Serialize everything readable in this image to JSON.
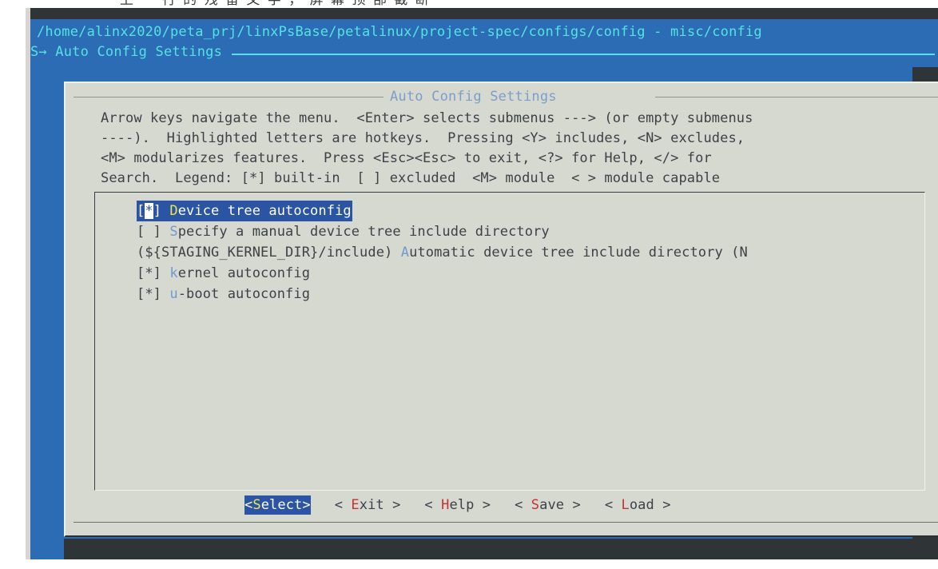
{
  "window": {
    "truncated_top_text": "上 一 行 的 残 留 文 字 ， 屏 幕 顶 部 截 断"
  },
  "terminal": {
    "path_title": "/home/alinx2020/peta_prj/linxPsBase/petalinux/project-spec/configs/config - misc/config",
    "breadcrumb": "S→ Auto Config Settings"
  },
  "dialog": {
    "title": "Auto Config Settings",
    "help_lines": [
      "Arrow keys navigate the menu.  <Enter> selects submenus ---> (or empty submenus",
      "----).  Highlighted letters are hotkeys.  Pressing <Y> includes, <N> excludes,",
      "<M> modularizes features.  Press <Esc><Esc> to exit, <?> for Help, </> for",
      "Search.  Legend: [*] built-in  [ ] excluded  <M> module  < > module capable"
    ],
    "menu_items": [
      {
        "prefix_open": "[",
        "cursor": "*",
        "prefix_close": "] ",
        "hotkey": "D",
        "label": "evice tree autoconfig",
        "selected": true
      },
      {
        "prefix": "[ ] ",
        "hotkey": "S",
        "label": "pecify a manual device tree include directory",
        "selected": false
      },
      {
        "prefix": "(${STAGING_KERNEL_DIR}/include) ",
        "hotkey": "A",
        "label": "utomatic device tree include directory (N",
        "selected": false
      },
      {
        "prefix": "[*] ",
        "hotkey": "k",
        "label": "ernel autoconfig",
        "selected": false
      },
      {
        "prefix": "[*] ",
        "hotkey": "u",
        "label": "-boot autoconfig",
        "selected": false
      }
    ],
    "buttons": [
      {
        "open": "<",
        "hotkey": "S",
        "label": "elect",
        "close": ">",
        "selected": true
      },
      {
        "open": "< ",
        "hotkey": "E",
        "label": "xit",
        "close": " >",
        "selected": false
      },
      {
        "open": "< ",
        "hotkey": "H",
        "label": "elp",
        "close": " >",
        "selected": false
      },
      {
        "open": "< ",
        "hotkey": "S",
        "label": "ave",
        "close": " >",
        "selected": false
      },
      {
        "open": "< ",
        "hotkey": "L",
        "label": "oad",
        "close": " >",
        "selected": false
      }
    ]
  },
  "colors": {
    "terminal_blue": "#2b6cb5",
    "cyan_text": "#55e2e2",
    "dialog_bg": "#d5d9d0",
    "selection_blue": "#2b54a4",
    "hotkey_blue": "#6f9ad0",
    "hotkey_red": "#cc2f2f",
    "hotkey_yellow": "#e8e84a",
    "title_blue": "#7d9ec8",
    "body_text": "#3d4247"
  }
}
